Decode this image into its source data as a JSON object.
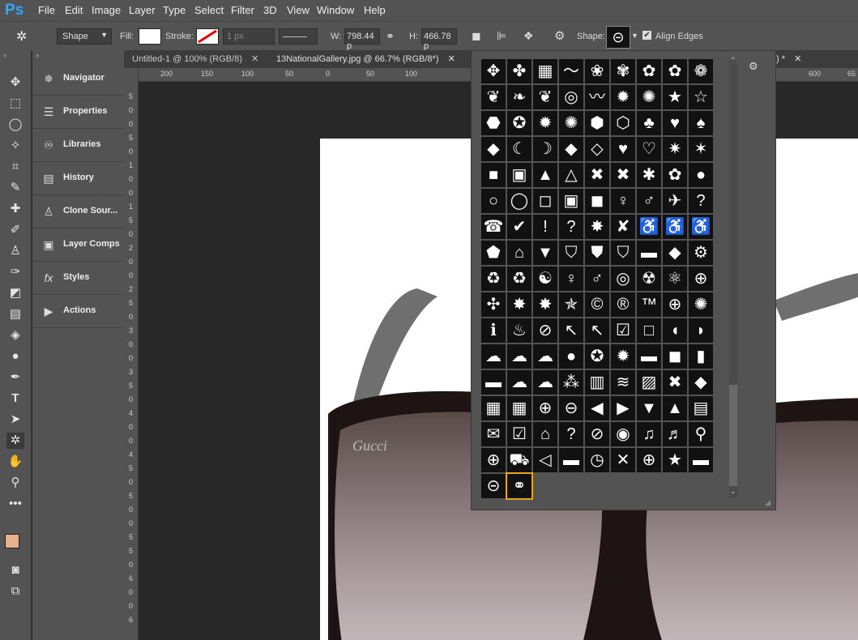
{
  "app": {
    "logo": "Ps"
  },
  "menu": [
    "File",
    "Edit",
    "Image",
    "Layer",
    "Type",
    "Select",
    "Filter",
    "3D",
    "View",
    "Window",
    "Help"
  ],
  "options": {
    "mode": "Shape",
    "fill_label": "Fill:",
    "stroke_label": "Stroke:",
    "stroke_width": "1 px",
    "w_label": "W:",
    "w_value": "798.44 p",
    "h_label": "H:",
    "h_value": "466.78 p",
    "shape_label": "Shape:",
    "align_edges": "Align Edges"
  },
  "panels": [
    {
      "label": "Navigator",
      "icon": "navigator-icon"
    },
    {
      "label": "Properties",
      "icon": "properties-icon"
    },
    {
      "label": "Libraries",
      "icon": "libraries-icon"
    },
    {
      "label": "History",
      "icon": "history-icon"
    },
    {
      "label": "Clone Sour...",
      "icon": "clone-source-icon"
    },
    {
      "label": "Layer Comps",
      "icon": "layer-comps-icon"
    },
    {
      "label": "Styles",
      "icon": "styles-icon"
    },
    {
      "label": "Actions",
      "icon": "actions-icon"
    }
  ],
  "tabs": {
    "t1": "Untitled-1 @ 100% (RGB/8)",
    "t2": "13NationalGallery.jpg @ 66.7% (RGB/8*)",
    "t3": ") *"
  },
  "ruler_h": [
    "200",
    "150",
    "100",
    "50",
    "0",
    "50",
    "100",
    "600",
    "65"
  ],
  "ruler_v": [
    "5",
    "0",
    "0",
    "5",
    "0",
    "1",
    "0",
    "0",
    "1",
    "5",
    "0",
    "2",
    "0",
    "0",
    "2",
    "5",
    "0",
    "3",
    "0",
    "0",
    "3",
    "5",
    "0",
    "4",
    "0",
    "0",
    "4",
    "5",
    "0",
    "5",
    "0",
    "0",
    "5",
    "5",
    "0",
    "6",
    "0",
    "0",
    "6"
  ],
  "shapes": [
    "✥",
    "✤",
    "▦",
    "〜",
    "❀",
    "✾",
    "✿",
    "✿",
    "❁",
    "❦",
    "❧",
    "❦",
    "◎",
    "〰",
    "✹",
    "✺",
    "★",
    "☆",
    "⬣",
    "✪",
    "✹",
    "✺",
    "⬢",
    "⬡",
    "♣",
    "♥",
    "♠",
    "◆",
    "☾",
    "☽",
    "◆",
    "◇",
    "♥",
    "♡",
    "✷",
    "✶",
    "■",
    "▣",
    "▲",
    "△",
    "✖",
    "✖",
    "✱",
    "✿",
    "●",
    "○",
    "◯",
    "◻",
    "▣",
    "◼",
    "♀",
    "♂",
    "✈",
    "?",
    "☎",
    "✔",
    "!",
    "?",
    "✸",
    "✘",
    "♿",
    "♿",
    "♿",
    "⬟",
    "⌂",
    "▼",
    "⛉",
    "⛊",
    "⛉",
    "▬",
    "◆",
    "⚙",
    "♻",
    "♻",
    "☯",
    "♀",
    "♂",
    "◎",
    "☢",
    "⚛",
    "⊕",
    "✣",
    "✸",
    "✸",
    "✯",
    "©",
    "®",
    "™",
    "⊕",
    "✺",
    "ℹ",
    "♨",
    "⊘",
    "↖",
    "↖",
    "☑",
    "□",
    "◖",
    "◗",
    "☁",
    "☁",
    "☁",
    "●",
    "✪",
    "✹",
    "▬",
    "◼",
    "▮",
    "▬",
    "☁",
    "☁",
    "⁂",
    "▥",
    "≋",
    "▨",
    "✖",
    "◆",
    "▦",
    "▦",
    "⊕",
    "⊖",
    "◀",
    "▶",
    "▼",
    "▲",
    "▤",
    "✉",
    "☑",
    "⌂",
    "?",
    "⊘",
    "◉",
    "♫",
    "♬",
    "⚲",
    "⊕",
    "⛟",
    "◁",
    "▬",
    "◷",
    "✕",
    "⊕",
    "★",
    "▬",
    "⊝",
    "⚭"
  ]
}
